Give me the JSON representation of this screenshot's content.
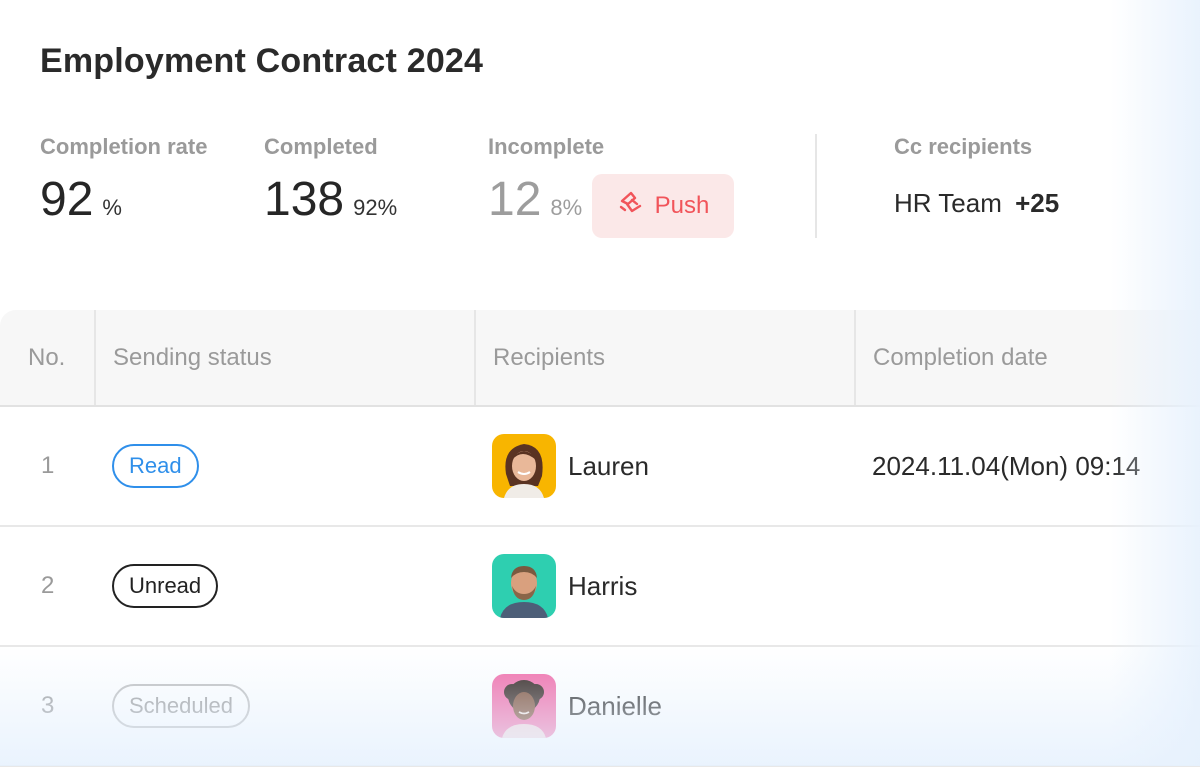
{
  "title": "Employment Contract 2024",
  "stats": {
    "completion_rate": {
      "label": "Completion rate",
      "value": "92",
      "unit": "%"
    },
    "completed": {
      "label": "Completed",
      "value": "138",
      "percent": "92%"
    },
    "incomplete": {
      "label": "Incomplete",
      "value": "12",
      "percent": "8%"
    }
  },
  "push_button": {
    "label": "Push",
    "icon": "push-alert-icon",
    "color": "#f1545a"
  },
  "cc_recipients": {
    "label": "Cc recipients",
    "value": "HR Team",
    "extra": "+25"
  },
  "table": {
    "headers": {
      "no": "No.",
      "status": "Sending status",
      "recipients": "Recipients",
      "date": "Completion date"
    },
    "rows": [
      {
        "no": "1",
        "status": "Read",
        "recipient": "Lauren",
        "avatar_bg": "#f8b500",
        "date": "2024.11.04(Mon) 09:14"
      },
      {
        "no": "2",
        "status": "Unread",
        "recipient": "Harris",
        "avatar_bg": "#2ecfb0",
        "date": ""
      },
      {
        "no": "3",
        "status": "Scheduled",
        "recipient": "Danielle",
        "avatar_bg": "#f26aa8",
        "date": ""
      }
    ]
  },
  "colors": {
    "read": "#2f8fea",
    "unread": "#222222",
    "scheduled": "#9a9a9a",
    "push_bg": "#fbe8e8"
  }
}
